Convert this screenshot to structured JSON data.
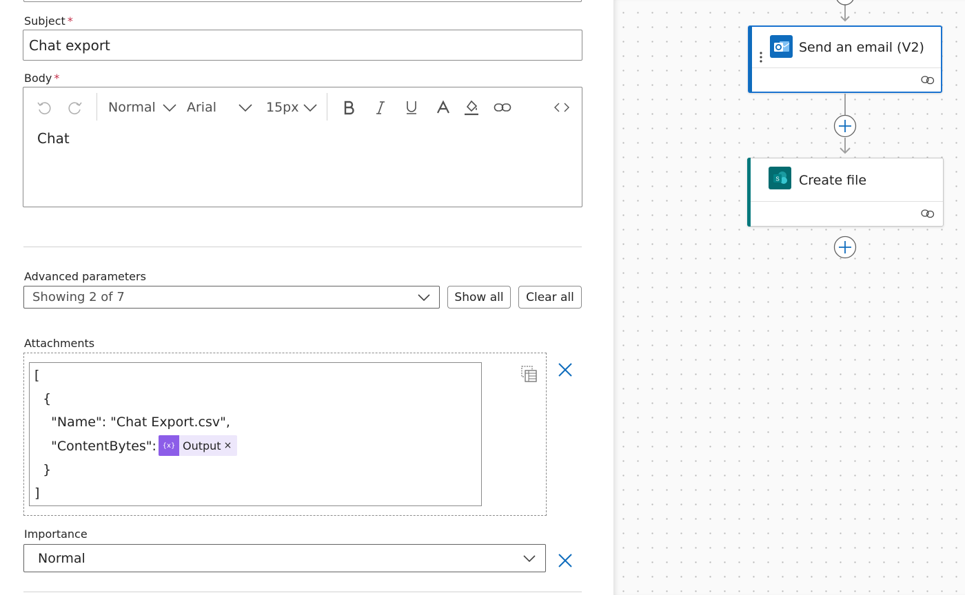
{
  "form": {
    "subject": {
      "label": "Subject",
      "required_mark": "*",
      "value": "Chat export"
    },
    "body": {
      "label": "Body",
      "required_mark": "*",
      "toolbar": {
        "style": "Normal",
        "font": "Arial",
        "size": "15px"
      },
      "content": "Chat"
    },
    "advanced": {
      "label": "Advanced parameters",
      "dropdown_value": "Showing 2 of 7",
      "show_all": "Show all",
      "clear_all": "Clear all"
    },
    "attachments": {
      "label": "Attachments",
      "lines": [
        "[",
        "  {",
        "    \"Name\": \"Chat Export.csv\",",
        "    \"ContentBytes\": ",
        "  }",
        "]"
      ],
      "token": {
        "icon_text": "{x}",
        "label": "Output",
        "remove": "×"
      }
    },
    "importance": {
      "label": "Importance",
      "value": "Normal"
    }
  },
  "canvas": {
    "steps": [
      {
        "title": "Send an email (V2)",
        "app": "outlook-icon",
        "accent": "#0f6cbd",
        "selected": true
      },
      {
        "title": "Create file",
        "app": "sharepoint-icon",
        "accent": "#03787c",
        "selected": false
      }
    ]
  },
  "colors": {
    "accent": "#0f6cbd",
    "required": "#c4314b",
    "token": "#8c5de8",
    "sharepoint": "#03787c"
  }
}
